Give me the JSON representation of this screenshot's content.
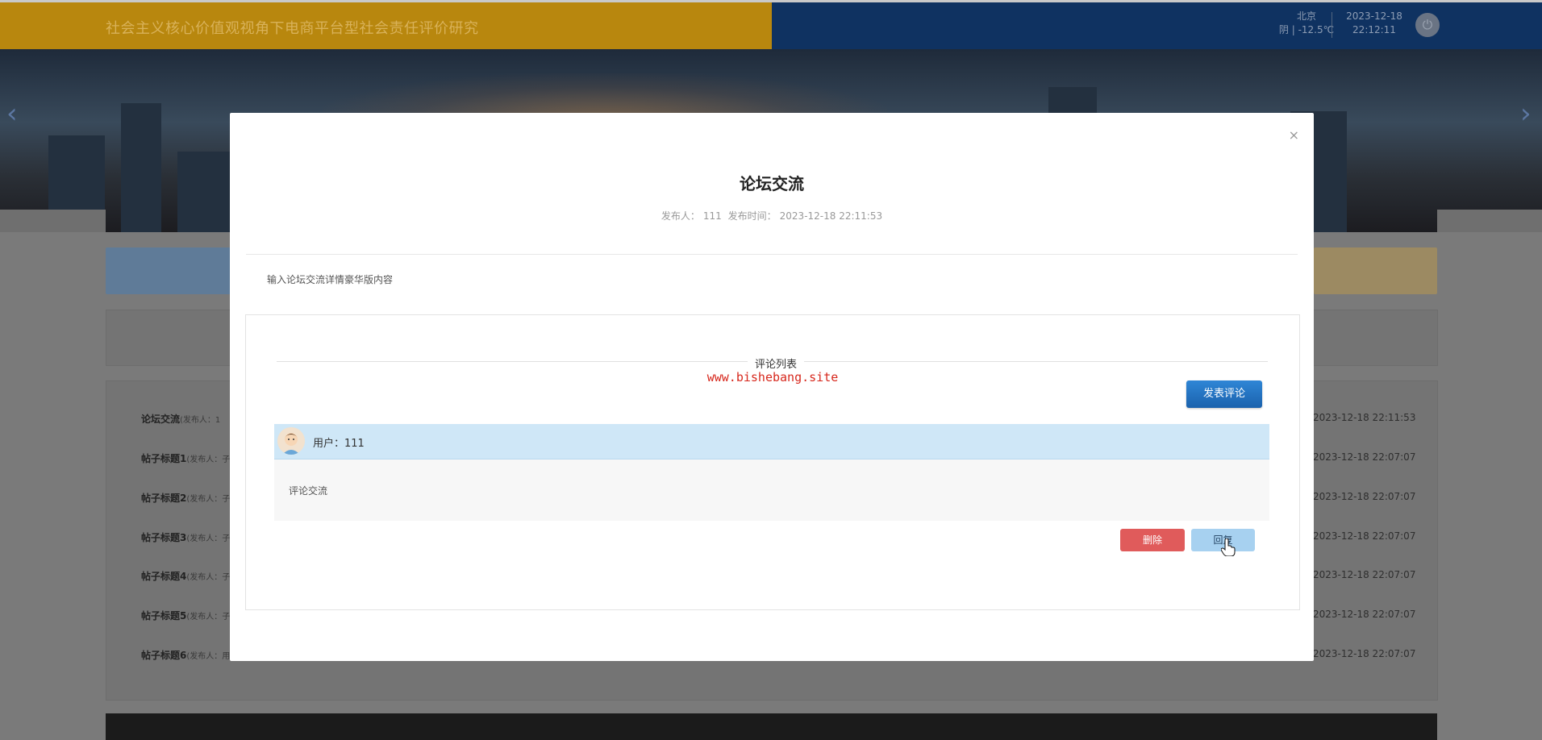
{
  "header": {
    "site_title": "社会主义核心价值观视角下电商平台型社会责任评价研究",
    "weather_city": "北京",
    "weather_desc": "阴 | -12.5℃",
    "date": "2023-12-18",
    "time": "22:12:11",
    "power_icon": "power-icon"
  },
  "banner": {
    "prev_icon": "chevron-left-icon",
    "next_icon": "chevron-right-icon"
  },
  "background_list": {
    "posts": [
      {
        "title": "论坛交流",
        "meta": "(发布人：1",
        "date": "2023-12-18 22:11:53"
      },
      {
        "title": "帖子标题1",
        "meta": "(发布人：子",
        "date": "2023-12-18 22:07:07"
      },
      {
        "title": "帖子标题2",
        "meta": "(发布人：子",
        "date": "2023-12-18 22:07:07"
      },
      {
        "title": "帖子标题3",
        "meta": "(发布人：子",
        "date": "2023-12-18 22:07:07"
      },
      {
        "title": "帖子标题4",
        "meta": "(发布人：子",
        "date": "2023-12-18 22:07:07"
      },
      {
        "title": "帖子标题5",
        "meta": "(发布人：子",
        "date": "2023-12-18 22:07:07"
      },
      {
        "title": "帖子标题6",
        "meta": "(发布人：用",
        "date": "2023-12-18 22:07:07"
      }
    ]
  },
  "modal": {
    "close_label": "×",
    "title": "论坛交流",
    "publisher_label": "发布人：",
    "publisher": "111",
    "publish_time_label": "发布时间：",
    "publish_time": "2023-12-18 22:11:53",
    "content": "输入论坛交流详情豪华版内容",
    "comments_title": "评论列表",
    "watermark": "www.bishebang.site",
    "post_comment_label": "发表评论",
    "comment": {
      "user_label": "用户：111",
      "text": "评论交流",
      "delete_label": "删除",
      "reply_label": "回复"
    }
  },
  "colors": {
    "header_left": "#b8870e",
    "header_right": "#0f3261",
    "primary_button": "#1f6fbf",
    "danger_button": "#e05b5b",
    "reply_button": "#a7d1f0",
    "comment_header": "#cfe7f7",
    "watermark": "#d7281d"
  }
}
